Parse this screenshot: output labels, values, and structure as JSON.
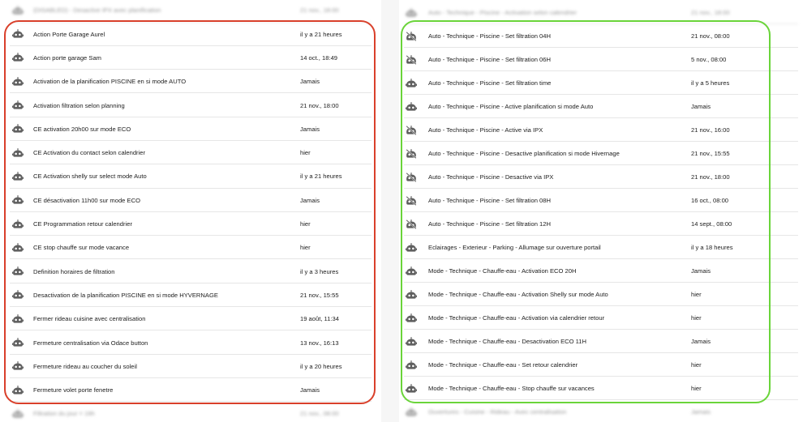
{
  "left_panel": {
    "blur_top": {
      "name": "(DISABLED) - Desactive IPX avec planification",
      "time": "21 nov., 18:00"
    },
    "items": [
      {
        "name": "Action Porte Garage Aurel",
        "time": "il y a 21 heures",
        "icon": "robot-icon"
      },
      {
        "name": "Action porte garage Sam",
        "time": "14 oct., 18:49",
        "icon": "robot-icon"
      },
      {
        "name": "Activation de la planification PISCINE en si mode AUTO",
        "time": "Jamais",
        "icon": "robot-icon"
      },
      {
        "name": "Activation filtration selon planning",
        "time": "21 nov., 18:00",
        "icon": "robot-icon"
      },
      {
        "name": "CE activation 20h00 sur mode ECO",
        "time": "Jamais",
        "icon": "robot-icon"
      },
      {
        "name": "CE Activation du contact selon calendrier",
        "time": "hier",
        "icon": "robot-icon"
      },
      {
        "name": "CE Activation shelly sur select mode Auto",
        "time": "il y a 21 heures",
        "icon": "robot-icon"
      },
      {
        "name": "CE désactivation 11h00 sur mode ECO",
        "time": "Jamais",
        "icon": "robot-icon"
      },
      {
        "name": "CE Programmation retour calendrier",
        "time": "hier",
        "icon": "robot-icon"
      },
      {
        "name": "CE stop chauffe sur mode vacance",
        "time": "hier",
        "icon": "robot-icon"
      },
      {
        "name": "Definition horaires de filtration",
        "time": "il y a 3 heures",
        "icon": "robot-icon"
      },
      {
        "name": "Desactivation de la planification PISCINE en si mode HYVERNAGE",
        "time": "21 nov., 15:55",
        "icon": "robot-icon"
      },
      {
        "name": "Fermer rideau cuisine avec centralisation",
        "time": "19 août, 11:34",
        "icon": "robot-icon"
      },
      {
        "name": "Fermeture centralisation via Odace button",
        "time": "13 nov., 16:13",
        "icon": "robot-icon"
      },
      {
        "name": "Fermeture rideau au coucher du soleil",
        "time": "il y a 20 heures",
        "icon": "robot-icon"
      },
      {
        "name": "Fermeture volet porte fenetre",
        "time": "Jamais",
        "icon": "robot-icon"
      }
    ],
    "blur_bottom": {
      "name": "Filtration du jour = 16h",
      "time": "21 nov., 08:00"
    }
  },
  "right_panel": {
    "blur_top": {
      "name": "Auto - Technique - Piscine - Activation selon calendrier",
      "time": "21 nov., 18:00"
    },
    "items": [
      {
        "name": "Auto - Technique - Piscine - Set filtration 04H",
        "time": "21 nov., 08:00",
        "icon": "robot-off-icon"
      },
      {
        "name": "Auto - Technique - Piscine - Set filtration 06H",
        "time": "5 nov., 08:00",
        "icon": "robot-off-icon"
      },
      {
        "name": "Auto - Technique - Piscine - Set filtration time",
        "time": "il y a 5 heures",
        "icon": "robot-icon"
      },
      {
        "name": "Auto - Technique - Piscine - Active planification si mode Auto",
        "time": "Jamais",
        "icon": "robot-icon"
      },
      {
        "name": "Auto - Technique - Piscine - Active via IPX",
        "time": "21 nov., 16:00",
        "icon": "robot-off-icon"
      },
      {
        "name": "Auto - Technique - Piscine - Desactive planification si mode Hivernage",
        "time": "21 nov., 15:55",
        "icon": "robot-off-icon"
      },
      {
        "name": "Auto - Technique - Piscine - Desactive via IPX",
        "time": "21 nov., 18:00",
        "icon": "robot-off-icon"
      },
      {
        "name": "Auto - Technique - Piscine - Set filtration 08H",
        "time": "16 oct., 08:00",
        "icon": "robot-off-icon"
      },
      {
        "name": "Auto - Technique - Piscine - Set filtration 12H",
        "time": "14 sept., 08:00",
        "icon": "robot-off-icon"
      },
      {
        "name": "Eclairages - Exterieur - Parking - Allumage sur ouverture portail",
        "time": "il y a 18 heures",
        "icon": "robot-icon"
      },
      {
        "name": "Mode - Technique - Chauffe-eau - Activation ECO 20H",
        "time": "Jamais",
        "icon": "robot-icon"
      },
      {
        "name": "Mode - Technique - Chauffe-eau - Activation Shelly sur mode Auto",
        "time": "hier",
        "icon": "robot-icon"
      },
      {
        "name": "Mode - Technique - Chauffe-eau - Activation via calendrier retour",
        "time": "hier",
        "icon": "robot-icon"
      },
      {
        "name": "Mode - Technique - Chauffe-eau - Desactivation ECO 11H",
        "time": "Jamais",
        "icon": "robot-icon"
      },
      {
        "name": "Mode - Technique - Chauffe-eau - Set retour calendrier",
        "time": "hier",
        "icon": "robot-icon"
      },
      {
        "name": "Mode - Technique - Chauffe-eau - Stop chauffe sur vacances",
        "time": "hier",
        "icon": "robot-icon"
      }
    ],
    "blur_bottom": {
      "name": "Ouvertures - Cuisine - Rideau - Avec centralisation",
      "time": "Jamais"
    }
  },
  "colors": {
    "red_frame": "#d9402b",
    "green_frame": "#6ad43a",
    "icon": "#5f5f5f"
  }
}
